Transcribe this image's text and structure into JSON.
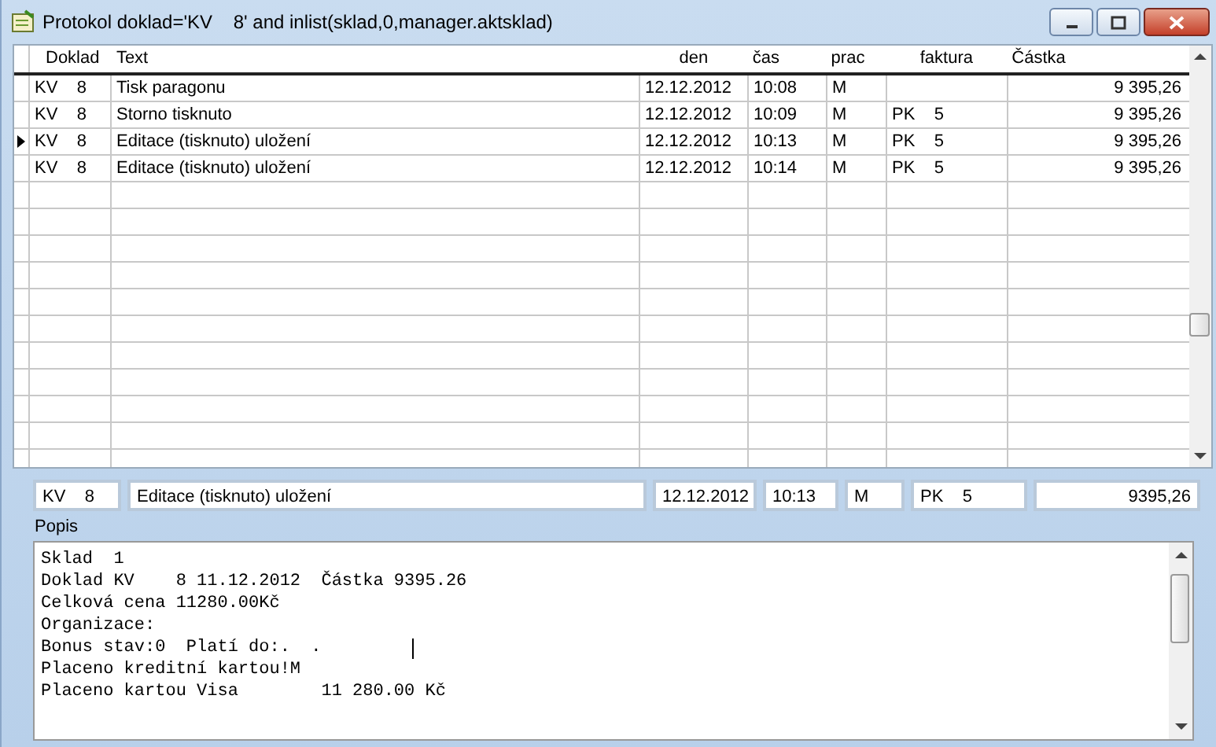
{
  "window": {
    "title": "Protokol doklad='KV    8' and inlist(sklad,0,manager.aktsklad)"
  },
  "table": {
    "columns": [
      "Doklad",
      "Text",
      "den",
      "čas",
      "prac",
      "faktura",
      "Částka"
    ],
    "rows": [
      {
        "doklad": "KV    8",
        "text": "Tisk paragonu",
        "den": "12.12.2012",
        "cas": "10:08",
        "prac": "M",
        "faktura": "",
        "castka": "9 395,26",
        "selected": false
      },
      {
        "doklad": "KV    8",
        "text": "Storno tisknuto",
        "den": "12.12.2012",
        "cas": "10:09",
        "prac": "M",
        "faktura": "PK    5",
        "castka": "9 395,26",
        "selected": false
      },
      {
        "doklad": "KV    8",
        "text": "Editace (tisknuto) uložení",
        "den": "12.12.2012",
        "cas": "10:13",
        "prac": "M",
        "faktura": "PK    5",
        "castka": "9 395,26",
        "selected": true
      },
      {
        "doklad": "KV    8",
        "text": "Editace (tisknuto) uložení",
        "den": "12.12.2012",
        "cas": "10:14",
        "prac": "M",
        "faktura": "PK    5",
        "castka": "9 395,26",
        "selected": false
      }
    ]
  },
  "detail": {
    "doklad": "KV    8",
    "text": "Editace (tisknuto) uložení",
    "den": "12.12.2012",
    "cas": "10:13",
    "prac": "M",
    "faktura": "PK    5",
    "castka": "9395,26"
  },
  "popis": {
    "label": "Popis",
    "lines": [
      "Sklad  1",
      "Doklad KV    8 11.12.2012  Částka 9395.26",
      "Celková cena 11280.00Kč",
      "Organizace:",
      "Bonus stav:0  Platí do:.  .",
      "Placeno kreditní kartou!M",
      "Placeno kartou Visa        11 280.00 Kč"
    ]
  }
}
